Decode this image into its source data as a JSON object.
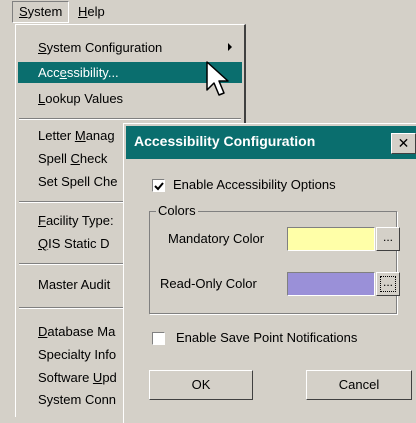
{
  "menubar": {
    "items": [
      {
        "label_u": "S",
        "label_rest": "ystem",
        "active": true
      },
      {
        "label_u": "H",
        "label_rest": "elp",
        "active": false
      }
    ]
  },
  "menu": {
    "items": [
      {
        "pre": "",
        "u": "S",
        "post": "ystem Configuration",
        "submenu": true,
        "selected": false
      },
      {
        "pre": "Acc",
        "u": "e",
        "post": "ssibility...",
        "submenu": false,
        "selected": true
      },
      {
        "pre": "",
        "u": "L",
        "post": "ookup Values",
        "submenu": false,
        "selected": false
      },
      {
        "pre": "Letter ",
        "u": "M",
        "post": "anag",
        "submenu": false,
        "selected": false
      },
      {
        "pre": "Spell ",
        "u": "C",
        "post": "heck",
        "submenu": false,
        "selected": false
      },
      {
        "pre": "Set Spell Che",
        "u": "",
        "post": "",
        "submenu": false,
        "selected": false
      },
      {
        "pre": "",
        "u": "F",
        "post": "acility Type:",
        "submenu": false,
        "selected": false
      },
      {
        "pre": "",
        "u": "Q",
        "post": "IS Static D",
        "submenu": false,
        "selected": false
      },
      {
        "pre": "Master Audit",
        "u": "",
        "post": "",
        "submenu": false,
        "selected": false
      },
      {
        "pre": "",
        "u": "D",
        "post": "atabase Ma",
        "submenu": false,
        "selected": false
      },
      {
        "pre": "Specialty Info",
        "u": "",
        "post": "",
        "submenu": false,
        "selected": false
      },
      {
        "pre": "Software ",
        "u": "U",
        "post": "pd",
        "submenu": false,
        "selected": false
      },
      {
        "pre": "System Conn",
        "u": "",
        "post": "",
        "submenu": false,
        "selected": false
      }
    ]
  },
  "dialog": {
    "title": "Accessibility Configuration",
    "close_glyph": "✕",
    "enable_accessibility": {
      "label": "Enable Accessibility Options",
      "checked": true
    },
    "colors_group": {
      "legend": "Colors",
      "mandatory_label": "Mandatory Color",
      "mandatory_color": "#ffffa8",
      "readonly_label": "Read-Only Color",
      "readonly_color": "#9a90d8",
      "browse_label": "..."
    },
    "enable_save_point": {
      "label": "Enable Save Point Notifications",
      "checked": false
    },
    "ok_label": "OK",
    "cancel_label": "Cancel"
  },
  "colors": {
    "accent": "#0a6e6e",
    "face": "#d4d0c8"
  },
  "icons": {
    "cursor": "arrow-cursor-icon",
    "check": "check-mark-icon",
    "submenu": "submenu-arrow-icon",
    "close": "close-icon"
  }
}
